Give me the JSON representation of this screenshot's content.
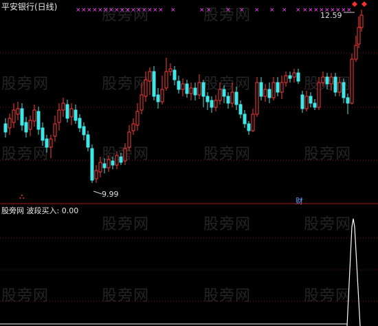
{
  "chart_title": "平安银行(日线)",
  "indicator_label": "股旁网 波段买入: 0.00",
  "high_label": "12.59",
  "low_label": "9.99",
  "flag_left": "⛬",
  "flag_right": "财",
  "watermark_text": "股旁网",
  "colors": {
    "up": "#ff3b3b",
    "down": "#3fe8e8",
    "grid": "#7a1010",
    "divider": "#b01818",
    "marker": "#ff40ff",
    "indicator": "#ffffff"
  },
  "chart_data": {
    "type": "candlestick",
    "price_low": 9.99,
    "price_high": 12.59,
    "indicator_value": 0.0,
    "indicator_peak": 1.0
  }
}
